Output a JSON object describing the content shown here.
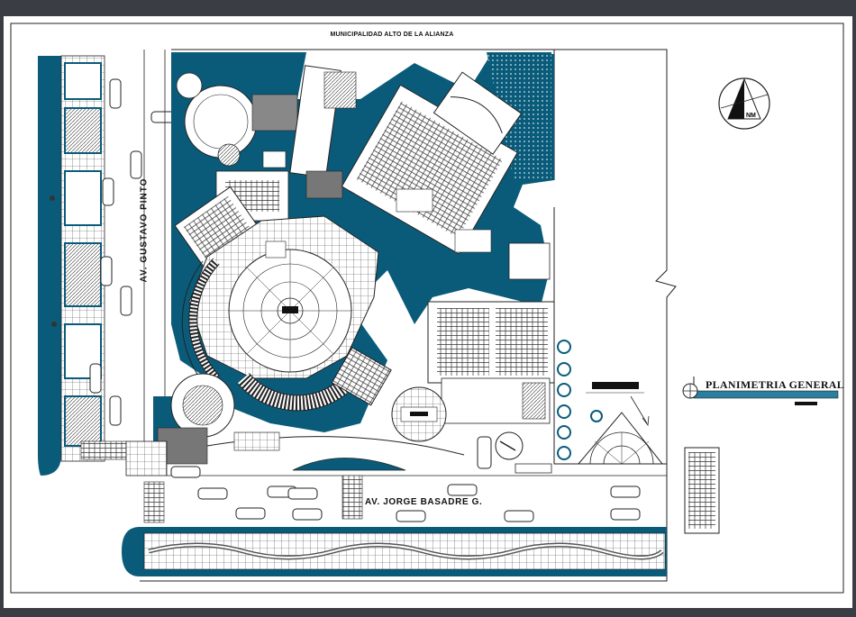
{
  "drawing": {
    "header_title": "MUNICIPALIDAD ALTO DE LA ALIANZA",
    "plan_title": "PLANIMETRIA GENERAL",
    "north_label": "NM"
  },
  "streets": {
    "vertical": "AV. GUSTAVO PINTO",
    "horizontal": "AV. JORGE BASADRE G."
  },
  "colors": {
    "background": "#ffffff",
    "teal": "#0a5b7a",
    "line": "#111111",
    "frame": "#3a3d44"
  }
}
